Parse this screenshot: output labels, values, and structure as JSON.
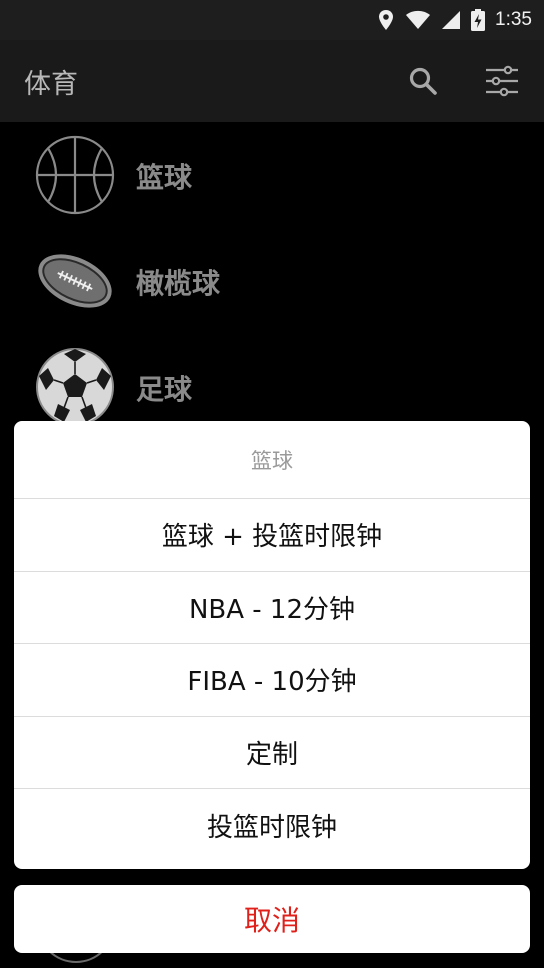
{
  "status_bar": {
    "time": "1:35",
    "icons": [
      "location-icon",
      "wifi-icon",
      "signal-icon",
      "battery-icon"
    ]
  },
  "app_bar": {
    "title": "体育",
    "icons": [
      "search-icon",
      "filter-icon"
    ]
  },
  "sports": [
    {
      "label": "篮球",
      "icon": "basketball-icon"
    },
    {
      "label": "橄榄球",
      "icon": "football-icon"
    },
    {
      "label": "足球",
      "icon": "soccer-ball-icon"
    }
  ],
  "dialog": {
    "title": "篮球",
    "options": [
      "篮球 + 投篮时限钟",
      "NBA - 12分钟",
      "FIBA - 10分钟",
      "定制",
      "投篮时限钟"
    ],
    "cancel": "取消"
  },
  "colors": {
    "accent_red": "#e0201a",
    "background": "#000000",
    "app_bar": "#1a1a1a"
  }
}
